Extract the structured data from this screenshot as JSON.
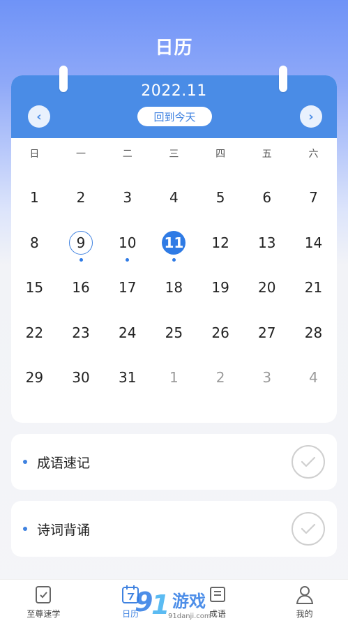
{
  "header": {
    "title": "日历"
  },
  "calendar": {
    "month_label": "2022.11",
    "today_button": "回到今天",
    "prev_glyph": "‹",
    "next_glyph": "›",
    "weekdays": [
      "日",
      "一",
      "二",
      "三",
      "四",
      "五",
      "六"
    ],
    "weeks": [
      [
        {
          "d": "1"
        },
        {
          "d": "2"
        },
        {
          "d": "3"
        },
        {
          "d": "4"
        },
        {
          "d": "5"
        },
        {
          "d": "6"
        },
        {
          "d": "7"
        }
      ],
      [
        {
          "d": "8"
        },
        {
          "d": "9",
          "state": "outlined",
          "dot": true
        },
        {
          "d": "10",
          "dot": true
        },
        {
          "d": "11",
          "state": "filled",
          "dot": true
        },
        {
          "d": "12"
        },
        {
          "d": "13"
        },
        {
          "d": "14"
        }
      ],
      [
        {
          "d": "15"
        },
        {
          "d": "16"
        },
        {
          "d": "17"
        },
        {
          "d": "18"
        },
        {
          "d": "19"
        },
        {
          "d": "20"
        },
        {
          "d": "21"
        }
      ],
      [
        {
          "d": "22"
        },
        {
          "d": "23"
        },
        {
          "d": "24"
        },
        {
          "d": "25"
        },
        {
          "d": "26"
        },
        {
          "d": "27"
        },
        {
          "d": "28"
        }
      ],
      [
        {
          "d": "29"
        },
        {
          "d": "30"
        },
        {
          "d": "31"
        },
        {
          "d": "1",
          "muted": true
        },
        {
          "d": "2",
          "muted": true
        },
        {
          "d": "3",
          "muted": true
        },
        {
          "d": "4",
          "muted": true
        }
      ]
    ]
  },
  "tasks": [
    {
      "label": "成语速记",
      "icon": "check-circle-icon"
    },
    {
      "label": "诗词背诵",
      "icon": "check-circle-icon"
    }
  ],
  "tabbar": {
    "items": [
      {
        "label": "至尊速学",
        "icon": "checklist-icon",
        "active": false
      },
      {
        "label": "日历",
        "icon": "calendar-icon",
        "active": true
      },
      {
        "label": "成语",
        "icon": "idiom-icon",
        "active": false
      },
      {
        "label": "我的",
        "icon": "profile-icon",
        "active": false
      }
    ]
  },
  "watermark": {
    "brand": "91游戏",
    "site": "91danji.com"
  },
  "colors": {
    "accent": "#3f82e0",
    "header_blue": "#4a8ce6",
    "selected_fill": "#2f7be5"
  }
}
